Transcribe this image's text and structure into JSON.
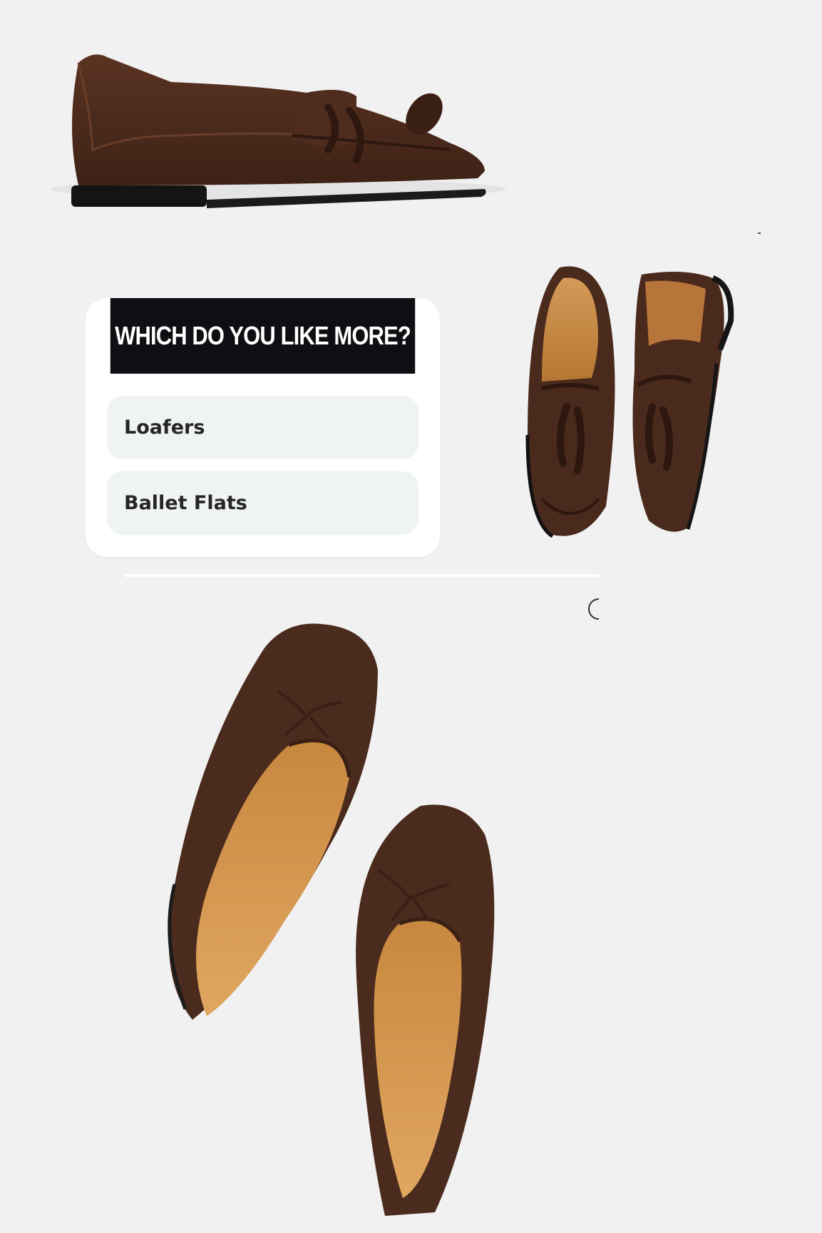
{
  "poll": {
    "question": "WHICH DO YOU LIKE MORE?",
    "options": [
      "Loafers",
      "Ballet Flats"
    ]
  },
  "images": {
    "loafer_side": "brown-suede-tassel-loafer-side",
    "loafer_pair": "brown-suede-tassel-loafers-top",
    "ballet_flats": "brown-suede-ballet-flats-top"
  },
  "colors": {
    "suede": "#4a2a1c",
    "lining": "#c98a4a",
    "header": "#0e0f12",
    "option_bg": "#f0f3f4"
  }
}
